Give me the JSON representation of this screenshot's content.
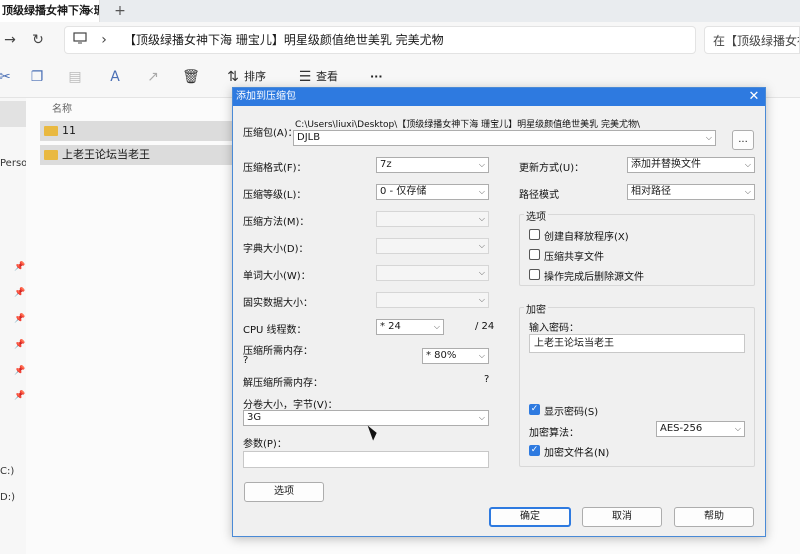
{
  "browser": {
    "tab_title": "顶级绿播女神下海 珊宝儿】明",
    "tab_close": "×",
    "new_tab": "+",
    "address": "【顶级绿播女神下海 珊宝儿】明星级颜值绝世美乳 完美尤物",
    "address_chevron": "›",
    "search_text": "在【顶级绿播女神"
  },
  "toolbar": {
    "sort_label": "排序",
    "view_label": "查看",
    "more_label": "···"
  },
  "leftpane": {
    "person_text": "Person",
    "drive1": "C:)",
    "drive2": "D:)"
  },
  "files": {
    "column_name": "名称",
    "items": [
      "11",
      "上老王论坛当老王"
    ]
  },
  "dialog": {
    "title": "添加到压缩包",
    "close": "✕",
    "archive_label": "压缩包(A)：",
    "archive_path": "C:\\Users\\liuxi\\Desktop\\【顶级绿播女神下海 珊宝儿】明星级颜值绝世美乳 完美尤物\\",
    "archive_name": "DJLB",
    "browse": "...",
    "format_label": "压缩格式(F)：",
    "format_value": "7z",
    "level_label": "压缩等级(L)：",
    "level_value": "0 - 仅存储",
    "method_label": "压缩方法(M)：",
    "dict_label": "字典大小(D)：",
    "word_label": "单词大小(W)：",
    "solid_label": "固实数据大小：",
    "threads_label": "CPU 线程数：",
    "threads_value": "* 24",
    "threads_max": "/ 24",
    "mem_label": "压缩所需内存：",
    "mem_q": "?",
    "mem_value": "* 80%",
    "decomp_label": "解压缩所需内存：",
    "decomp_q": "?",
    "split_label": "分卷大小，字节(V)：",
    "split_value": "3G",
    "params_label": "参数(P)：",
    "options_btn": "选项",
    "update_label": "更新方式(U)：",
    "update_value": "添加并替换文件",
    "path_label": "路径模式",
    "path_value": "相对路径",
    "opt_group": "选项",
    "opt_sfx": "创建自释放程序(X)",
    "opt_shared": "压缩共享文件",
    "opt_delete": "操作完成后删除源文件",
    "enc_group": "加密",
    "pwd_label": "输入密码：",
    "pwd_value": "上老王论坛当老王",
    "show_pwd": "显示密码(S)",
    "enc_method_label": "加密算法：",
    "enc_method_value": "AES-256",
    "enc_names": "加密文件名(N)",
    "ok": "确定",
    "cancel": "取消",
    "help": "帮助"
  }
}
